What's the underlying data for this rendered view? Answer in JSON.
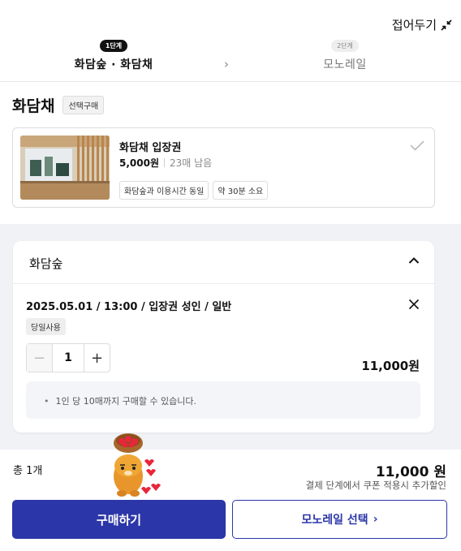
{
  "header": {
    "collapse_label": "접어두기"
  },
  "steps": [
    {
      "badge": "1단계",
      "label": "화담숲 · 화담채"
    },
    {
      "badge": "2단계",
      "label": "모노레일"
    }
  ],
  "section": {
    "title": "화담채",
    "mode_tag": "선택구매"
  },
  "product": {
    "name": "화담채 입장권",
    "price": "5,000원",
    "remaining": "23매 남음",
    "tags": [
      "화담숲과 이용시간 동일",
      "약 30분 소요"
    ]
  },
  "cart": {
    "title": "화담숲",
    "item_desc": "2025.05.01 / 13:00 / 입장권 성인 / 일반",
    "use_tag": "당일사용",
    "quantity": "1",
    "item_price": "11,000원",
    "notice": "1인 당 10매까지 구매할 수 있습니다."
  },
  "summary": {
    "total_label": "총 1개",
    "total_amount": "11,000 원",
    "discount_note": "결제 단계에서 쿠폰 적용시 추가할인"
  },
  "actions": {
    "buy_label": "구매하기",
    "monorail_label": "모노레일 선택"
  },
  "colors": {
    "primary": "#2b36a8",
    "gray_bg": "#f1f2f6"
  }
}
